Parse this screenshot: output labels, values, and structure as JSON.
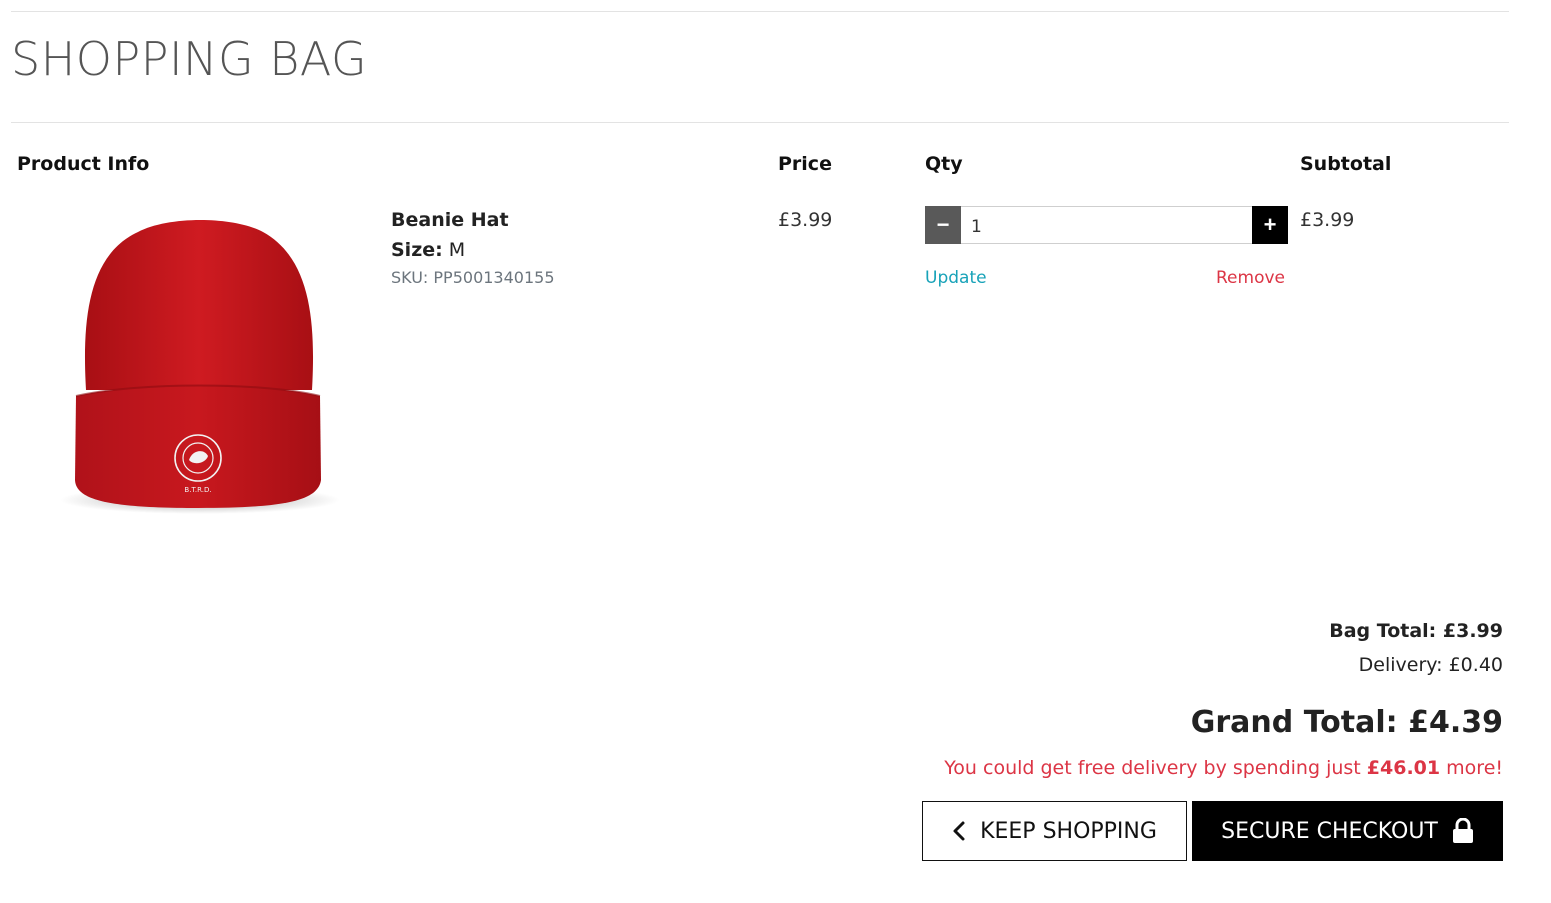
{
  "page": {
    "title": "SHOPPING BAG"
  },
  "table": {
    "headers": {
      "product": "Product Info",
      "price": "Price",
      "qty": "Qty",
      "subtotal": "Subtotal"
    }
  },
  "item": {
    "name": "Beanie Hat",
    "size_label": "Size:",
    "size_value": "M",
    "sku": "SKU: PP5001340155",
    "price": "£3.99",
    "qty": "1",
    "update_label": "Update",
    "remove_label": "Remove",
    "subtotal": "£3.99",
    "image": {
      "color": "#c4161c",
      "logo_text": "B.T.R.D."
    }
  },
  "summary": {
    "bag_total": "Bag Total: £3.99",
    "delivery": "Delivery: £0.40",
    "grand_total": "Grand Total: £4.39",
    "free_delivery_prefix": "You could get free delivery by spending just ",
    "free_delivery_amount": "£46.01",
    "free_delivery_suffix": " more!"
  },
  "buttons": {
    "keep_shopping": "KEEP SHOPPING",
    "keep_shopping_icon": "chevron-left-icon",
    "secure_checkout": "SECURE CHECKOUT",
    "secure_checkout_icon": "lock-icon"
  },
  "colors": {
    "link": "#17a2b8",
    "danger": "#dc3545",
    "checkout_bg": "#000000"
  }
}
